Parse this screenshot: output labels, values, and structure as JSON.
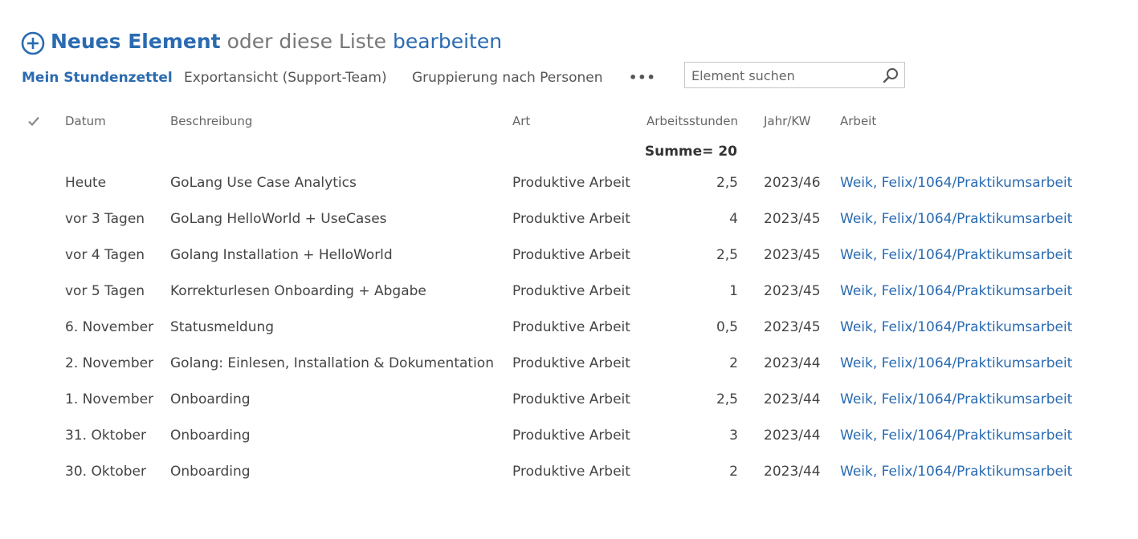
{
  "header": {
    "new_item_label": "Neues Element",
    "or_text": "oder diese Liste",
    "edit_label": "bearbeiten"
  },
  "views": {
    "current": "Mein Stundenzettel",
    "items": [
      "Exportansicht (Support-Team)",
      "Gruppierung nach Personen"
    ],
    "more": "•••"
  },
  "search": {
    "placeholder": "Element suchen",
    "value": ""
  },
  "table": {
    "columns": [
      "Datum",
      "Beschreibung",
      "Art",
      "Arbeitsstunden",
      "Jahr/KW",
      "Arbeit"
    ],
    "total": "Summe= 20",
    "rows": [
      {
        "datum": "Heute",
        "beschreibung": "GoLang Use Case Analytics",
        "art": "Produktive Arbeit",
        "stunden": "2,5",
        "kw": "2023/46",
        "arbeit": "Weik, Felix/1064/Praktikumsarbeit"
      },
      {
        "datum": "vor 3 Tagen",
        "beschreibung": "GoLang HelloWorld + UseCases",
        "art": "Produktive Arbeit",
        "stunden": "4",
        "kw": "2023/45",
        "arbeit": "Weik, Felix/1064/Praktikumsarbeit"
      },
      {
        "datum": "vor 4 Tagen",
        "beschreibung": "Golang Installation + HelloWorld",
        "art": "Produktive Arbeit",
        "stunden": "2,5",
        "kw": "2023/45",
        "arbeit": "Weik, Felix/1064/Praktikumsarbeit"
      },
      {
        "datum": "vor 5 Tagen",
        "beschreibung": "Korrekturlesen Onboarding + Abgabe",
        "art": "Produktive Arbeit",
        "stunden": "1",
        "kw": "2023/45",
        "arbeit": "Weik, Felix/1064/Praktikumsarbeit"
      },
      {
        "datum": "6. November",
        "beschreibung": "Statusmeldung",
        "art": "Produktive Arbeit",
        "stunden": "0,5",
        "kw": "2023/45",
        "arbeit": "Weik, Felix/1064/Praktikumsarbeit"
      },
      {
        "datum": "2. November",
        "beschreibung": "Golang: Einlesen, Installation & Dokumentation",
        "art": "Produktive Arbeit",
        "stunden": "2",
        "kw": "2023/44",
        "arbeit": "Weik, Felix/1064/Praktikumsarbeit"
      },
      {
        "datum": "1. November",
        "beschreibung": "Onboarding",
        "art": "Produktive Arbeit",
        "stunden": "2,5",
        "kw": "2023/44",
        "arbeit": "Weik, Felix/1064/Praktikumsarbeit"
      },
      {
        "datum": "31. Oktober",
        "beschreibung": "Onboarding",
        "art": "Produktive Arbeit",
        "stunden": "3",
        "kw": "2023/44",
        "arbeit": "Weik, Felix/1064/Praktikumsarbeit"
      },
      {
        "datum": "30. Oktober",
        "beschreibung": "Onboarding",
        "art": "Produktive Arbeit",
        "stunden": "2",
        "kw": "2023/44",
        "arbeit": "Weik, Felix/1064/Praktikumsarbeit"
      }
    ]
  }
}
